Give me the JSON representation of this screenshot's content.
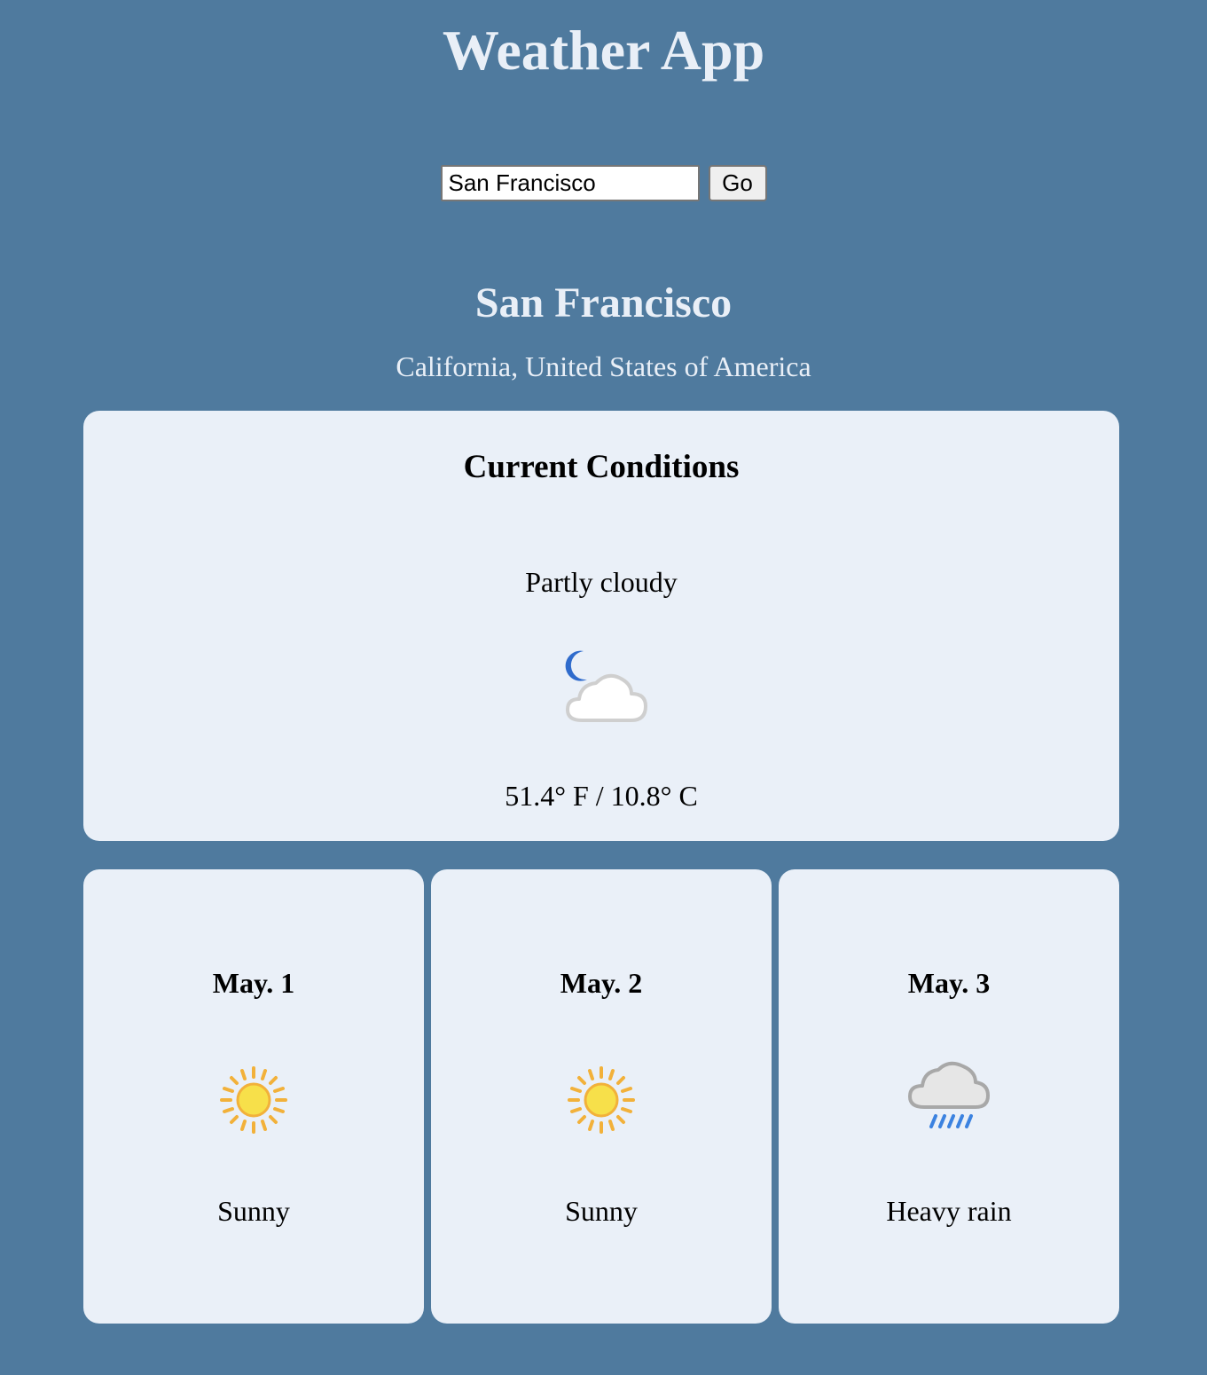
{
  "app": {
    "title": "Weather App"
  },
  "search": {
    "value": "San Francisco",
    "button_label": "Go"
  },
  "location": {
    "city": "San Francisco",
    "region": "California, United States of America"
  },
  "current": {
    "heading": "Current Conditions",
    "condition": "Partly cloudy",
    "icon": "moon-cloud-icon",
    "temperature": "51.4° F / 10.8° C"
  },
  "forecast": [
    {
      "date": "May. 1",
      "condition": "Sunny",
      "icon": "sun-icon"
    },
    {
      "date": "May. 2",
      "condition": "Sunny",
      "icon": "sun-icon"
    },
    {
      "date": "May. 3",
      "condition": "Heavy rain",
      "icon": "rain-cloud-icon"
    }
  ],
  "colors": {
    "background": "#4f7a9e",
    "card": "#eaf0f8",
    "heading_text": "#e9eff7",
    "sun": "#f7e04a",
    "sun_rays": "#f2b13a",
    "moon": "#2f6bcc",
    "rain": "#3b82e0"
  }
}
